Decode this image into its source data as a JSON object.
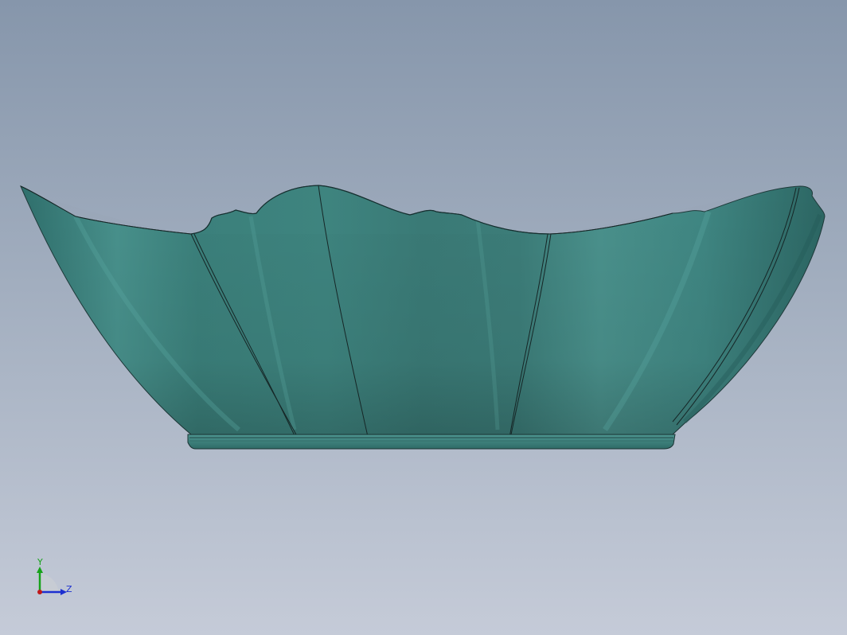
{
  "viewport": {
    "background_top": "#8696ab",
    "background_bottom": "#c5cbd8"
  },
  "model": {
    "body_color": "#3f8a84",
    "edge_color": "#1a2a2a"
  },
  "triad": {
    "y_label": "Y",
    "z_label": "Z",
    "y_color": "#16a21a",
    "z_color": "#1c2fd0"
  }
}
